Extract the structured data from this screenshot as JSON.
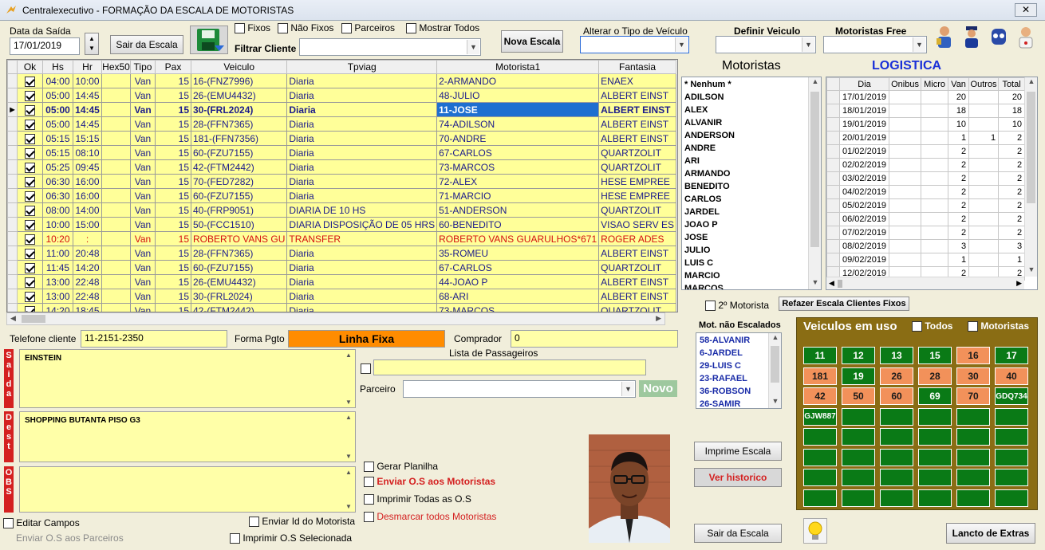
{
  "window": {
    "title": "Centralexecutivo - FORMAÇÃO DA ESCALA DE MOTORISTAS",
    "close": "✕"
  },
  "toolbar": {
    "data_saida_label": "Data da Saída",
    "data_saida_value": "17/01/2019",
    "sair_escala_label": "Sair da Escala",
    "fixos_label": "Fixos",
    "nao_fixos_label": "Não Fixos",
    "parceiros_label": "Parceiros",
    "mostrar_todos_label": "Mostrar Todos",
    "filtrar_cliente_label": "Filtrar Cliente",
    "filtrar_cliente_value": "",
    "nova_escala_label": "Nova Escala",
    "alterar_tipo_label": "Alterar o Tipo de Veículo",
    "definir_veiculo_label": "Definir Veiculo",
    "motoristas_free_label": "Motoristas Free"
  },
  "grid": {
    "columns": [
      "Ok",
      "Hs",
      "Hr",
      "Hex50",
      "Tipo",
      "Pax",
      "Veiculo",
      "Tpviag",
      "Motorista1",
      "Fantasia"
    ],
    "rows": [
      {
        "ok": true,
        "hs": "04:00",
        "hr": "10:00",
        "hex50": "",
        "tipo": "Van",
        "pax": "15",
        "veiculo": "16-(FNZ7996)",
        "tpviag": "Diaria",
        "motorista": "2-ARMANDO",
        "fantasia": "ENAEX"
      },
      {
        "ok": true,
        "hs": "05:00",
        "hr": "14:45",
        "hex50": "",
        "tipo": "Van",
        "pax": "15",
        "veiculo": "26-(EMU4432)",
        "tpviag": "Diaria",
        "motorista": "48-JULIO",
        "fantasia": "ALBERT EINST"
      },
      {
        "ok": true,
        "hs": "05:00",
        "hr": "14:45",
        "hex50": "",
        "tipo": "Van",
        "pax": "15",
        "veiculo": "30-(FRL2024)",
        "tpviag": "Diaria",
        "motorista": "11-JOSE",
        "fantasia": "ALBERT EINST"
      },
      {
        "ok": true,
        "hs": "05:00",
        "hr": "14:45",
        "hex50": "",
        "tipo": "Van",
        "pax": "15",
        "veiculo": "28-(FFN7365)",
        "tpviag": "Diaria",
        "motorista": "74-ADILSON",
        "fantasia": "ALBERT EINST"
      },
      {
        "ok": true,
        "hs": "05:15",
        "hr": "15:15",
        "hex50": "",
        "tipo": "Van",
        "pax": "15",
        "veiculo": "181-(FFN7356)",
        "tpviag": "Diaria",
        "motorista": "70-ANDRE",
        "fantasia": "ALBERT EINST"
      },
      {
        "ok": true,
        "hs": "05:15",
        "hr": "08:10",
        "hex50": "",
        "tipo": "Van",
        "pax": "15",
        "veiculo": "60-(FZU7155)",
        "tpviag": "Diaria",
        "motorista": "67-CARLOS",
        "fantasia": "QUARTZOLIT"
      },
      {
        "ok": true,
        "hs": "05:25",
        "hr": "09:45",
        "hex50": "",
        "tipo": "Van",
        "pax": "15",
        "veiculo": "42-(FTM2442)",
        "tpviag": "Diaria",
        "motorista": "73-MARCOS",
        "fantasia": "QUARTZOLIT"
      },
      {
        "ok": true,
        "hs": "06:30",
        "hr": "16:00",
        "hex50": "",
        "tipo": "Van",
        "pax": "15",
        "veiculo": "70-(FED7282)",
        "tpviag": "Diaria",
        "motorista": "72-ALEX",
        "fantasia": "HESE EMPREE"
      },
      {
        "ok": true,
        "hs": "06:30",
        "hr": "16:00",
        "hex50": "",
        "tipo": "Van",
        "pax": "15",
        "veiculo": "60-(FZU7155)",
        "tpviag": "Diaria",
        "motorista": "71-MARCIO",
        "fantasia": "HESE EMPREE"
      },
      {
        "ok": true,
        "hs": "08:00",
        "hr": "14:00",
        "hex50": "",
        "tipo": "Van",
        "pax": "15",
        "veiculo": "40-(FRP9051)",
        "tpviag": "DIARIA DE 10 HS",
        "motorista": "51-ANDERSON",
        "fantasia": "QUARTZOLIT"
      },
      {
        "ok": true,
        "hs": "10:00",
        "hr": "15:00",
        "hex50": "",
        "tipo": "Van",
        "pax": "15",
        "veiculo": "50-(FCC1510)",
        "tpviag": "DIARIA DISPOSIÇÃO DE 05 HRS",
        "motorista": "60-BENEDITO",
        "fantasia": "VISAO SERV ES"
      },
      {
        "ok": true,
        "hs": "10:20",
        "hr": ":",
        "hex50": "",
        "tipo": "Van",
        "pax": "15",
        "veiculo": "ROBERTO VANS GU",
        "tpviag": "TRANSFER",
        "motorista": "ROBERTO VANS GUARULHOS*671",
        "fantasia": "ROGER ADES"
      },
      {
        "ok": true,
        "hs": "11:00",
        "hr": "20:48",
        "hex50": "",
        "tipo": "Van",
        "pax": "15",
        "veiculo": "28-(FFN7365)",
        "tpviag": "Diaria",
        "motorista": "35-ROMEU",
        "fantasia": "ALBERT EINST"
      },
      {
        "ok": true,
        "hs": "11:45",
        "hr": "14:20",
        "hex50": "",
        "tipo": "Van",
        "pax": "15",
        "veiculo": "60-(FZU7155)",
        "tpviag": "Diaria",
        "motorista": "67-CARLOS",
        "fantasia": "QUARTZOLIT"
      },
      {
        "ok": true,
        "hs": "13:00",
        "hr": "22:48",
        "hex50": "",
        "tipo": "Van",
        "pax": "15",
        "veiculo": "26-(EMU4432)",
        "tpviag": "Diaria",
        "motorista": "44-JOAO P",
        "fantasia": "ALBERT EINST"
      },
      {
        "ok": true,
        "hs": "13:00",
        "hr": "22:48",
        "hex50": "",
        "tipo": "Van",
        "pax": "15",
        "veiculo": "30-(FRL2024)",
        "tpviag": "Diaria",
        "motorista": "68-ARI",
        "fantasia": "ALBERT EINST"
      },
      {
        "ok": true,
        "hs": "14:20",
        "hr": "18:45",
        "hex50": "",
        "tipo": "Van",
        "pax": "15",
        "veiculo": "42-(FTM2442)",
        "tpviag": "Diaria",
        "motorista": "73-MARCOS",
        "fantasia": "QUARTZOLIT"
      }
    ]
  },
  "motoristas": {
    "title": "Motoristas",
    "items": [
      "* Nenhum *",
      "ADILSON",
      "ALEX",
      "ALVANIR",
      "ANDERSON",
      "ANDRE",
      "ARI",
      "ARMANDO",
      "BENEDITO",
      "CARLOS",
      "JARDEL",
      "JOAO P",
      "JOSE",
      "JULIO",
      "LUIS C",
      "MARCIO",
      "MARCOS"
    ]
  },
  "logistica": {
    "title": "LOGISTICA",
    "columns": [
      "Dia",
      "Onibus",
      "Micro",
      "Van",
      "Outros",
      "Total"
    ],
    "rows": [
      [
        "17/01/2019",
        "",
        "",
        "20",
        "",
        "20"
      ],
      [
        "18/01/2019",
        "",
        "",
        "18",
        "",
        "18"
      ],
      [
        "19/01/2019",
        "",
        "",
        "10",
        "",
        "10"
      ],
      [
        "20/01/2019",
        "",
        "",
        "1",
        "1",
        "2"
      ],
      [
        "01/02/2019",
        "",
        "",
        "2",
        "",
        "2"
      ],
      [
        "02/02/2019",
        "",
        "",
        "2",
        "",
        "2"
      ],
      [
        "03/02/2019",
        "",
        "",
        "2",
        "",
        "2"
      ],
      [
        "04/02/2019",
        "",
        "",
        "2",
        "",
        "2"
      ],
      [
        "05/02/2019",
        "",
        "",
        "2",
        "",
        "2"
      ],
      [
        "06/02/2019",
        "",
        "",
        "2",
        "",
        "2"
      ],
      [
        "07/02/2019",
        "",
        "",
        "2",
        "",
        "2"
      ],
      [
        "08/02/2019",
        "",
        "",
        "3",
        "",
        "3"
      ],
      [
        "09/02/2019",
        "",
        "",
        "1",
        "",
        "1"
      ],
      [
        "12/02/2019",
        "",
        "",
        "2",
        "",
        "2"
      ]
    ]
  },
  "segundo_motorista_label": "2º Motorista",
  "refazer_escala_label": "Refazer Escala Clientes Fixos",
  "mot_nao_escalados": {
    "title": "Mot. não Escalados",
    "items": [
      "58-ALVANIR",
      "6-JARDEL",
      "29-LUIS C",
      "23-RAFAEL",
      "36-ROBSON",
      "26-SAMIR"
    ]
  },
  "veiculos": {
    "title": "Veiculos em uso",
    "todos_label": "Todos",
    "motoristas_label": "Motoristas",
    "cells": [
      {
        "t": "11",
        "c": "g"
      },
      {
        "t": "12",
        "c": "g"
      },
      {
        "t": "13",
        "c": "g"
      },
      {
        "t": "15",
        "c": "g"
      },
      {
        "t": "16",
        "c": "o"
      },
      {
        "t": "17",
        "c": "g"
      },
      {
        "t": "181",
        "c": "o"
      },
      {
        "t": "19",
        "c": "g"
      },
      {
        "t": "26",
        "c": "o"
      },
      {
        "t": "28",
        "c": "o"
      },
      {
        "t": "30",
        "c": "o"
      },
      {
        "t": "40",
        "c": "o"
      },
      {
        "t": "42",
        "c": "o"
      },
      {
        "t": "50",
        "c": "o"
      },
      {
        "t": "60",
        "c": "o"
      },
      {
        "t": "69",
        "c": "g"
      },
      {
        "t": "70",
        "c": "o"
      },
      {
        "t": "GDQ734",
        "c": "g sm"
      },
      {
        "t": "GJW887",
        "c": "g sm"
      },
      {
        "t": "",
        "c": "g"
      },
      {
        "t": "",
        "c": "g"
      },
      {
        "t": "",
        "c": "g"
      },
      {
        "t": "",
        "c": "g"
      },
      {
        "t": "",
        "c": "g"
      },
      {
        "t": "",
        "c": "g"
      },
      {
        "t": "",
        "c": "g"
      },
      {
        "t": "",
        "c": "g"
      },
      {
        "t": "",
        "c": "g"
      },
      {
        "t": "",
        "c": "g"
      },
      {
        "t": "",
        "c": "g"
      },
      {
        "t": "",
        "c": "g"
      },
      {
        "t": "",
        "c": "g"
      },
      {
        "t": "",
        "c": "g"
      },
      {
        "t": "",
        "c": "g"
      },
      {
        "t": "",
        "c": "g"
      },
      {
        "t": "",
        "c": "g"
      },
      {
        "t": "",
        "c": "g"
      },
      {
        "t": "",
        "c": "g"
      },
      {
        "t": "",
        "c": "g"
      },
      {
        "t": "",
        "c": "g"
      },
      {
        "t": "",
        "c": "g"
      },
      {
        "t": "",
        "c": "g"
      },
      {
        "t": "",
        "c": "g"
      },
      {
        "t": "",
        "c": "g"
      },
      {
        "t": "",
        "c": "g"
      },
      {
        "t": "",
        "c": "g"
      },
      {
        "t": "",
        "c": "g"
      },
      {
        "t": "",
        "c": "g"
      }
    ]
  },
  "detail": {
    "telefone_label": "Telefone cliente",
    "telefone_value": "11-2151-2350",
    "forma_pgto_label": "Forma Pgto",
    "forma_pgto_value": "Linha Fixa",
    "comprador_label": "Comprador",
    "comprador_value": "0",
    "saida_side": "S\na\ni\nd\na",
    "saida_text": "EINSTEIN",
    "dest_side": "D\ne\ns\nt",
    "dest_text": "SHOPPING BUTANTA   PISO G3",
    "obs_side": "O\nB\nS",
    "obs_text": "",
    "lista_passageiros_label": "Lista de Passageiros",
    "parceiro_label": "Parceiro",
    "novo_label": "Novo",
    "gerar_planilha": "Gerar Planilha",
    "enviar_os_motoristas": "Enviar O.S  aos Motoristas",
    "imprimir_todas_os": "Imprimir Todas as O.S",
    "desmarcar_todos": "Desmarcar todos Motoristas",
    "editar_campos": "Editar Campos",
    "enviar_id_motorista": "Enviar Id do Motorista",
    "enviar_os_parceiros": "Enviar O.S aos Parceiros",
    "imprimir_os_selecionada": "Imprimir O.S Selecionada"
  },
  "bottom_buttons": {
    "imprime_escala": "Imprime Escala",
    "ver_historico": "Ver historico",
    "sair_escala": "Sair da Escala",
    "lancto_extras": "Lancto de Extras"
  },
  "colors": {
    "grid_bg": "#ffff99",
    "selected": "#1e6fd0",
    "red": "#d42020",
    "panel": "#8a6d14",
    "green": "#0a7a16",
    "orange": "#f2915a"
  }
}
